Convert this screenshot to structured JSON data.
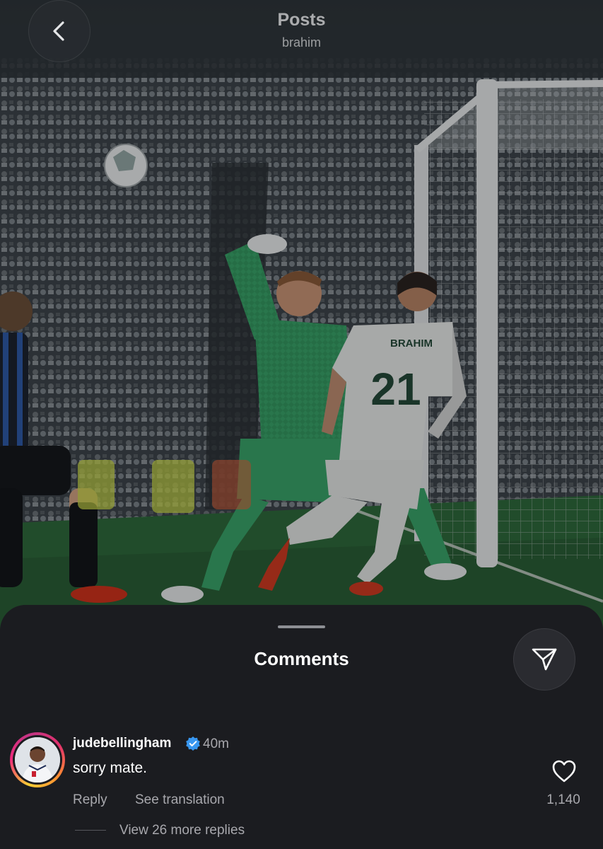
{
  "header": {
    "title": "Posts",
    "subtitle": "brahim",
    "back_icon": "chevron-left-icon"
  },
  "photo": {
    "jersey_name": "BRAHIM",
    "jersey_number": "21"
  },
  "comments_sheet": {
    "title": "Comments",
    "share_icon": "send-icon"
  },
  "comment": {
    "username": "judebellingham",
    "verified_icon": "verified-badge-icon",
    "time": "40m",
    "text": "sorry mate.",
    "reply_label": "Reply",
    "translate_label": "See translation",
    "like_icon": "heart-icon",
    "like_count": "1,140",
    "view_replies_label": "View 26 more replies"
  },
  "colors": {
    "sheet_bg": "#1b1c20",
    "muted_text": "#a8a8ad",
    "verified": "#3897f0",
    "keeper_kit": "#3aa46a",
    "pitch": "#2f6a3c"
  }
}
